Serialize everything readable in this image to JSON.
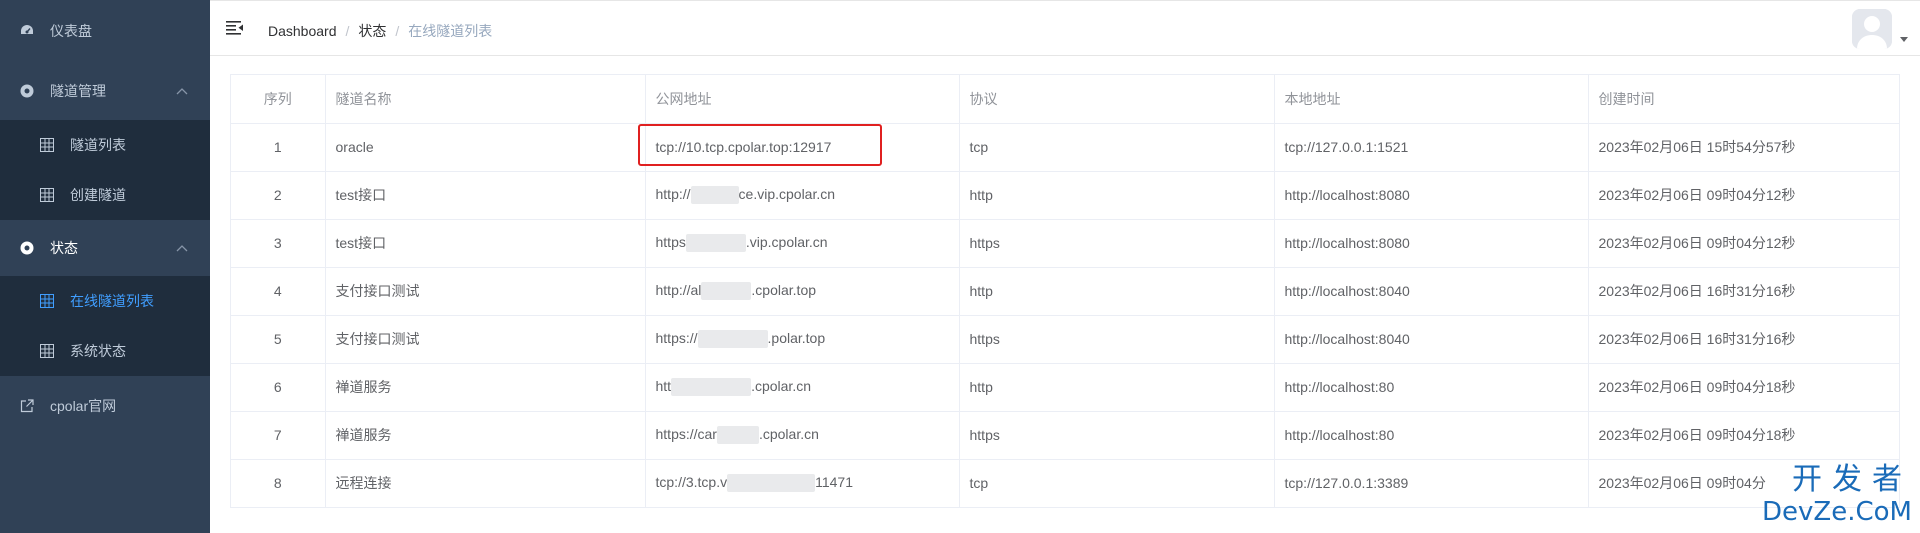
{
  "sidebar": {
    "items": [
      {
        "label": "仪表盘",
        "icon": "dashboard-icon"
      },
      {
        "label": "隧道管理",
        "icon": "tunnel-manage-icon"
      },
      {
        "label": "隧道列表",
        "icon": "grid-icon"
      },
      {
        "label": "创建隧道",
        "icon": "grid-icon"
      },
      {
        "label": "状态",
        "icon": "status-icon"
      },
      {
        "label": "在线隧道列表",
        "icon": "grid-icon"
      },
      {
        "label": "系统状态",
        "icon": "grid-icon"
      },
      {
        "label": "cpolar官网",
        "icon": "external-link-icon"
      }
    ],
    "active_color": "#409eff"
  },
  "header": {
    "breadcrumb": [
      "Dashboard",
      "状态",
      "在线隧道列表"
    ],
    "separator": "/"
  },
  "table": {
    "columns": [
      "序列",
      "隧道名称",
      "公网地址",
      "协议",
      "本地地址",
      "创建时间"
    ],
    "rows": [
      {
        "seq": "1",
        "name": "oracle",
        "public_a": "tcp://10.tcp.cpolar.top:12917",
        "public_b": "",
        "protocol": "tcp",
        "local": "tcp://127.0.0.1:1521",
        "created": "2023年02月06日 15时54分57秒"
      },
      {
        "seq": "2",
        "name": "test接口",
        "public_a": "http://",
        "public_b": "ce.vip.cpolar.cn",
        "protocol": "http",
        "local": "http://localhost:8080",
        "created": "2023年02月06日 09时04分12秒"
      },
      {
        "seq": "3",
        "name": "test接口",
        "public_a": "https",
        "public_b": ".vip.cpolar.cn",
        "protocol": "https",
        "local": "http://localhost:8080",
        "created": "2023年02月06日 09时04分12秒"
      },
      {
        "seq": "4",
        "name": "支付接口测试",
        "public_a": "http://al",
        "public_b": ".cpolar.top",
        "protocol": "http",
        "local": "http://localhost:8040",
        "created": "2023年02月06日 16时31分16秒"
      },
      {
        "seq": "5",
        "name": "支付接口测试",
        "public_a": "https://",
        "public_b": ".polar.top",
        "protocol": "https",
        "local": "http://localhost:8040",
        "created": "2023年02月06日 16时31分16秒"
      },
      {
        "seq": "6",
        "name": "禅道服务",
        "public_a": "htt",
        "public_b": ".cpolar.cn",
        "protocol": "http",
        "local": "http://localhost:80",
        "created": "2023年02月06日 09时04分18秒"
      },
      {
        "seq": "7",
        "name": "禅道服务",
        "public_a": "https://car",
        "public_b": ".cpolar.cn",
        "protocol": "https",
        "local": "http://localhost:80",
        "created": "2023年02月06日 09时04分18秒"
      },
      {
        "seq": "8",
        "name": "远程连接",
        "public_a": "tcp://3.tcp.v",
        "public_b": "11471",
        "protocol": "tcp",
        "local": "tcp://127.0.0.1:3389",
        "created": "2023年02月06日 09时04分"
      }
    ]
  },
  "highlight_color": "#e02020",
  "watermark": {
    "cn": "开发者",
    "en": "DevZe.CoM"
  }
}
